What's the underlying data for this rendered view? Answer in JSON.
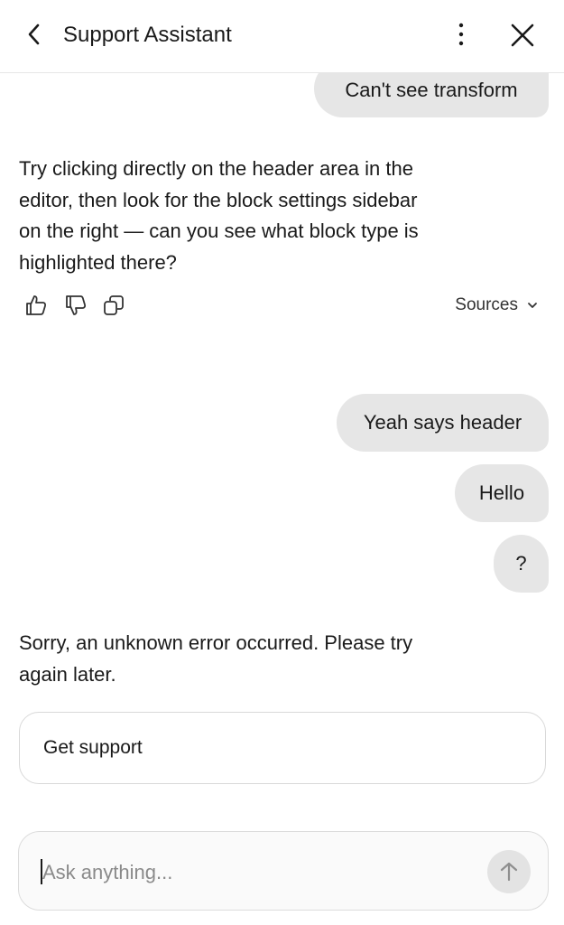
{
  "header": {
    "title": "Support Assistant",
    "back_icon": "chevron-left-icon",
    "more_icon": "vertical-ellipsis-icon",
    "close_icon": "close-icon"
  },
  "messages": {
    "user_1": "Can't see transform",
    "assistant_1": "Try clicking directly on the header area in the editor, then look for the block settings sidebar on the right — can you see what block type is highlighted there?",
    "sources_label": "Sources",
    "user_2": "Yeah says header",
    "user_3": "Hello",
    "user_4": "?",
    "assistant_2": "Sorry, an unknown error occurred. Please try again later.",
    "support_button": "Get support"
  },
  "composer": {
    "placeholder": "Ask anything...",
    "value": ""
  },
  "colors": {
    "user_bubble": "#e6e6e6",
    "text": "#1a1a1a",
    "border": "#d9d9d9",
    "send_button": "#e3e3e3"
  }
}
